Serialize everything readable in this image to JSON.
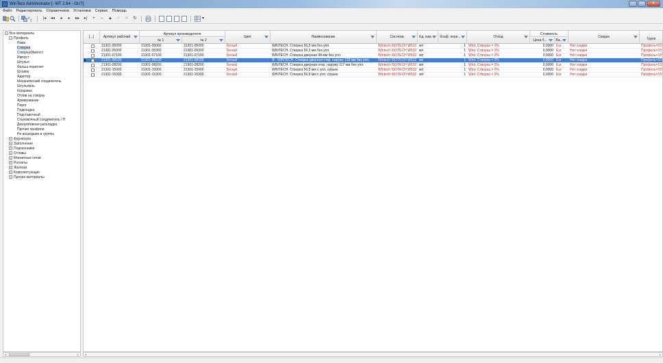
{
  "window": {
    "title": "WinTecs Administrator [- WT 2.64 - OUT]",
    "min": "–",
    "max": "□",
    "close": "✕"
  },
  "menu": [
    "Файл",
    "Редактировать",
    "Справочники",
    "Установки",
    "Сервис",
    "Помощь"
  ],
  "toolbar": {
    "nav": [
      "|◂",
      "◂◂",
      "◂",
      "▸",
      "▸▸",
      "▸|",
      "+",
      "–",
      "▲",
      "✓",
      "✕",
      "↻"
    ],
    "grid_menu_caret": "▾"
  },
  "tree": {
    "root": "Все материалы",
    "profiles_group": "Профиль",
    "profiles": [
      "Рама",
      "Створка",
      "Створка/Импост",
      "Импост",
      "Штульп",
      "Фальш переплет",
      "Штапик",
      "Адаптер",
      "Механический соединитель",
      "Штульпиль",
      "Концовка",
      "Отлив на створку",
      "Армирование",
      "Порог",
      "Подкладка",
      "Подставочный",
      "Стыковочный соединитель / П",
      "Декоративная раскладка",
      "Прочие профили",
      "Не вошедшие в группы"
    ],
    "groups": [
      "Фурнитура",
      "Заполнение",
      "Подоконники",
      "Отливы",
      "Москитные сетки",
      "Роллеты",
      "Жалюзи",
      "Комплектующие",
      "Прочие материалы"
    ],
    "expand_sign": "+",
    "collapse_sign": "–"
  },
  "grid": {
    "headers": {
      "select": "[...]",
      "article": "Артикул рабочий",
      "manufacturer_group": "Артикул производителя",
      "mfr1": "№ 1",
      "mfr2": "№ 2",
      "color": "Цвет",
      "name": "Наименование",
      "system": "Система",
      "unit": "Ед. изм.",
      "coef": "Коэф. пере...",
      "waste": "Отход",
      "cost_group": "Стоимость",
      "price": "Цена б...",
      "currency": "Ва...",
      "discount": "Скидка",
      "group": "Групп"
    },
    "rows": [
      {
        "article": "21301-05000",
        "mfr1": "21301-05000",
        "mfr2": "21301-05000",
        "color": "Белый",
        "name": "WINTECH. Створка 56,5 мм без упл.",
        "system": "Wintech ISOTECH W532",
        "unit": "мп",
        "coef": "1",
        "waste": "Wint. Створка = 0%",
        "price": "0,0000",
        "currency": "Eur",
        "discount": "Нет скидки",
        "group": "Профиль=15%"
      },
      {
        "article": "21301-05300",
        "mfr1": "21301-05300",
        "mfr2": "21301-05300",
        "color": "Белый",
        "name": "WINTECH. Створка 56,5 мм без упл.",
        "system": "Wintech ISOTECH W532",
        "unit": "мп",
        "coef": "1",
        "waste": "Wint. Створка = 0%",
        "price": "0,0000",
        "currency": "Eur",
        "discount": "Нет скидки",
        "group": "Профиль=15%"
      },
      {
        "article": "21301-07100",
        "mfr1": "21301-07100",
        "mfr2": "21301-07100",
        "color": "Белый",
        "name": "WINTECH. Створка дверная 98 мм без упл.",
        "system": "Wintech ISOTECH W532",
        "unit": "мп",
        "coef": "1",
        "waste": "Wint. Створка = 0%",
        "price": "0,0000",
        "currency": "Eur",
        "discount": "Нет скидки",
        "group": "Профиль=15%"
      },
      {
        "article": "21301-08100",
        "mfr1": "21301-08100",
        "mfr2": "21301-08100",
        "color": "Белый",
        "name": "Я - WINTECH. Створка дверная откр. наружу 118 мм без упл.",
        "system": "Wintech ISOTECH W532",
        "unit": "мп",
        "coef": "1",
        "waste": "Wint. Створка = 0%",
        "price": "0,0000",
        "currency": "Eur",
        "discount": "Нет скидки",
        "group": "Профиль=15%",
        "selected": true
      },
      {
        "article": "21301-08200",
        "mfr1": "21301-08200",
        "mfr2": "21301-08200",
        "color": "Белый",
        "name": "WINTECH. Створка дверная откр. наружу 117 мм без упл.",
        "system": "Wintech ISOTECH W532",
        "unit": "мп",
        "coef": "1",
        "waste": "Wint. Створка = 0%",
        "price": "0,0000",
        "currency": "Eur",
        "discount": "Нет скидки",
        "group": "Профиль=15%"
      },
      {
        "article": "21301-15000",
        "mfr1": "21301-15000",
        "mfr2": "21301-15000",
        "color": "Белый",
        "name": "WINTECH. Створка 56,5 мм с упл. серым",
        "system": "Wintech ISOTECH W532",
        "unit": "мп",
        "coef": "1",
        "waste": "Wint. Створка = 0%",
        "price": "0,0000",
        "currency": "Eur",
        "discount": "Нет скидки",
        "group": "Профиль=15%"
      },
      {
        "article": "21301-15300",
        "mfr1": "21301-15300",
        "mfr2": "21301-15300",
        "color": "Белый",
        "name": "WINTECH. Створка 56,5 мм с упл. серым",
        "system": "Wintech ISOTECH W532",
        "unit": "мп",
        "coef": "1",
        "waste": "Wint. Створка = 0%",
        "price": "0,0000",
        "currency": "Eur",
        "discount": "Нет скидки",
        "group": "Профиль=15%"
      }
    ]
  },
  "colors": {
    "selection": "#3d7fd6",
    "red_text": "#c03030",
    "filter_icon": "#5c86c0"
  }
}
